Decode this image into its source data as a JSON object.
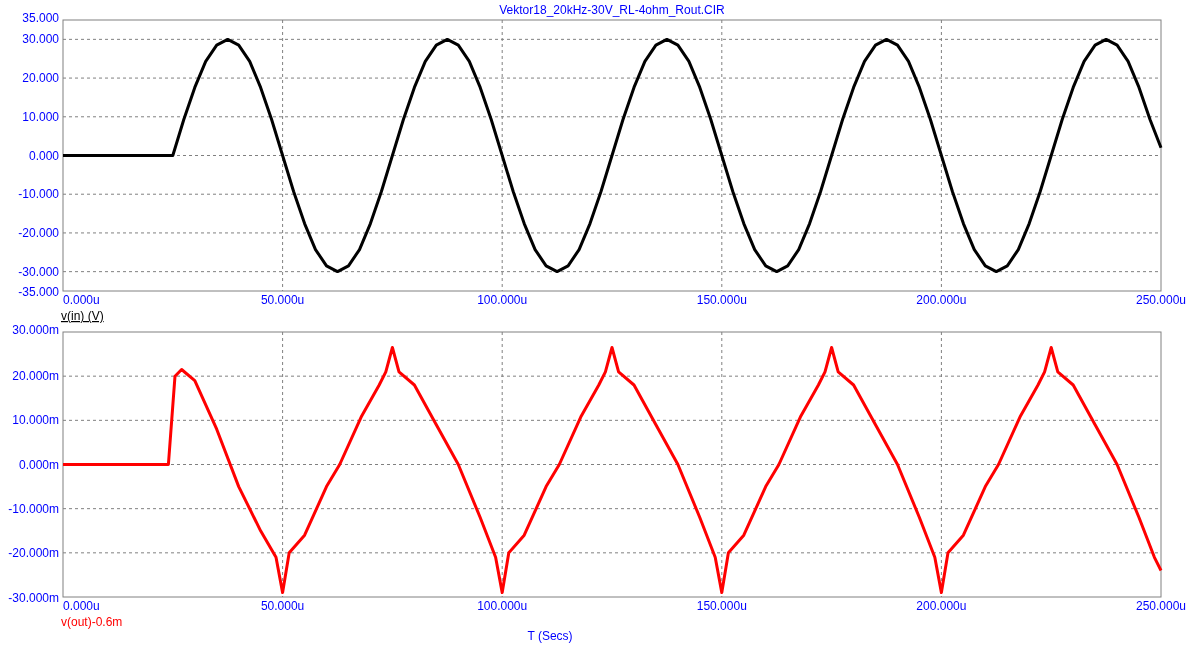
{
  "plots": [
    {
      "chart_data": {
        "type": "line",
        "title": "Vektor18_20kHz-30V_RL-4ohm_Rout.CIR",
        "grid": true,
        "xlim": [
          0,
          250
        ],
        "ylim": [
          -35,
          35
        ],
        "xticks": [
          {
            "value": 0,
            "label": "0.000u"
          },
          {
            "value": 50,
            "label": "50.000u"
          },
          {
            "value": 100,
            "label": "100.000u"
          },
          {
            "value": 150,
            "label": "150.000u"
          },
          {
            "value": 200,
            "label": "200.000u"
          },
          {
            "value": 250,
            "label": "250.000u"
          }
        ],
        "yticks": [
          {
            "value": 35,
            "label": "35.000"
          },
          {
            "value": 30,
            "label": "30.000"
          },
          {
            "value": 20,
            "label": "20.000"
          },
          {
            "value": 10,
            "label": "10.000"
          },
          {
            "value": 0,
            "label": "0.000"
          },
          {
            "value": -10,
            "label": "-10.000"
          },
          {
            "value": -20,
            "label": "-20.000"
          },
          {
            "value": -30,
            "label": "-30.000"
          },
          {
            "value": -35,
            "label": "-35.000"
          }
        ],
        "x": [
          0,
          2.5,
          5,
          7.5,
          10,
          12.5,
          15,
          17.5,
          20,
          22.5,
          25,
          27.5,
          30,
          32.5,
          35,
          37.5,
          40,
          42.5,
          45,
          47.5,
          50,
          52.5,
          55,
          57.5,
          60,
          62.5,
          65,
          67.5,
          70,
          72.5,
          75,
          77.5,
          80,
          82.5,
          85,
          87.5,
          90,
          92.5,
          95,
          97.5,
          100,
          102.5,
          105,
          107.5,
          110,
          112.5,
          115,
          117.5,
          120,
          122.5,
          125,
          127.5,
          130,
          132.5,
          135,
          137.5,
          140,
          142.5,
          145,
          147.5,
          150,
          152.5,
          155,
          157.5,
          160,
          162.5,
          165,
          167.5,
          170,
          172.5,
          175,
          177.5,
          180,
          182.5,
          185,
          187.5,
          190,
          192.5,
          195,
          197.5,
          200,
          202.5,
          205,
          207.5,
          210,
          212.5,
          215,
          217.5,
          220,
          222.5,
          225,
          227.5,
          230,
          232.5,
          235,
          237.5,
          240,
          242.5,
          245,
          247.5,
          250
        ],
        "series": [
          {
            "name": "v(in) (V)",
            "color": "#000000",
            "values": [
              0,
              0,
              0,
              0,
              0,
              0,
              0,
              0,
              0,
              0,
              0,
              9.3,
              17.6,
              24.3,
              28.5,
              30,
              28.5,
              24.3,
              17.6,
              9.3,
              0,
              -9.3,
              -17.6,
              -24.3,
              -28.5,
              -30,
              -28.5,
              -24.3,
              -17.6,
              -9.3,
              0,
              9.3,
              17.6,
              24.3,
              28.5,
              30,
              28.5,
              24.3,
              17.6,
              9.3,
              0,
              -9.3,
              -17.6,
              -24.3,
              -28.5,
              -30,
              -28.5,
              -24.3,
              -17.6,
              -9.3,
              0,
              9.3,
              17.6,
              24.3,
              28.5,
              30,
              28.5,
              24.3,
              17.6,
              9.3,
              0,
              -9.3,
              -17.6,
              -24.3,
              -28.5,
              -30,
              -28.5,
              -24.3,
              -17.6,
              -9.3,
              0,
              9.3,
              17.6,
              24.3,
              28.5,
              30,
              28.5,
              24.3,
              17.6,
              9.3,
              0,
              -9.3,
              -17.6,
              -24.3,
              -28.5,
              -30,
              -28.5,
              -24.3,
              -17.6,
              -9.3,
              0,
              9.3,
              17.6,
              24.3,
              28.5,
              30,
              28.5,
              24.3,
              17.6,
              9.3,
              2
            ]
          }
        ]
      }
    },
    {
      "chart_data": {
        "type": "line",
        "xlabel": "T (Secs)",
        "grid": true,
        "xlim": [
          0,
          250
        ],
        "ylim": [
          -30,
          30
        ],
        "xticks": [
          {
            "value": 0,
            "label": "0.000u"
          },
          {
            "value": 50,
            "label": "50.000u"
          },
          {
            "value": 100,
            "label": "100.000u"
          },
          {
            "value": 150,
            "label": "150.000u"
          },
          {
            "value": 200,
            "label": "200.000u"
          },
          {
            "value": 250,
            "label": "250.000u"
          }
        ],
        "yticks": [
          {
            "value": 30,
            "label": "30.000m"
          },
          {
            "value": 20,
            "label": "20.000m"
          },
          {
            "value": 10,
            "label": "10.000m"
          },
          {
            "value": 0,
            "label": "0.000m"
          },
          {
            "value": -10,
            "label": "-10.000m"
          },
          {
            "value": -20,
            "label": "-20.000m"
          },
          {
            "value": -30,
            "label": "-30.000m"
          }
        ],
        "x": [
          0,
          24,
          25.5,
          27,
          30,
          35,
          40,
          45,
          48.5,
          50,
          51.5,
          55,
          60,
          63,
          68,
          72,
          73.5,
          75,
          76.5,
          80,
          85,
          90,
          95,
          98.5,
          100,
          101.5,
          105,
          110,
          113,
          118,
          122,
          123.5,
          125,
          126.5,
          130,
          135,
          140,
          145,
          148.5,
          150,
          151.5,
          155,
          160,
          163,
          168,
          172,
          173.5,
          175,
          176.5,
          180,
          185,
          190,
          195,
          198.5,
          200,
          201.5,
          205,
          210,
          213,
          218,
          222,
          223.5,
          225,
          226.5,
          230,
          235,
          240,
          245,
          248.5,
          250
        ],
        "series": [
          {
            "name": "v(out)-0.6m",
            "color": "#ff0000",
            "values": [
              0,
              0,
              20,
              21.5,
              19,
              8,
              -5,
              -15,
              -21,
              -29,
              -20,
              -16,
              -5,
              0,
              11,
              18,
              21,
              26.5,
              21,
              18,
              9,
              0,
              -12,
              -21,
              -29,
              -20,
              -16,
              -5,
              0,
              11,
              18,
              21,
              26.5,
              21,
              18,
              9,
              0,
              -12,
              -21,
              -29,
              -20,
              -16,
              -5,
              0,
              11,
              18,
              21,
              26.5,
              21,
              18,
              9,
              0,
              -12,
              -21,
              -29,
              -20,
              -16,
              -5,
              0,
              11,
              18,
              21,
              26.5,
              21,
              18,
              9,
              0,
              -12,
              -21,
              -24
            ]
          }
        ]
      }
    }
  ]
}
